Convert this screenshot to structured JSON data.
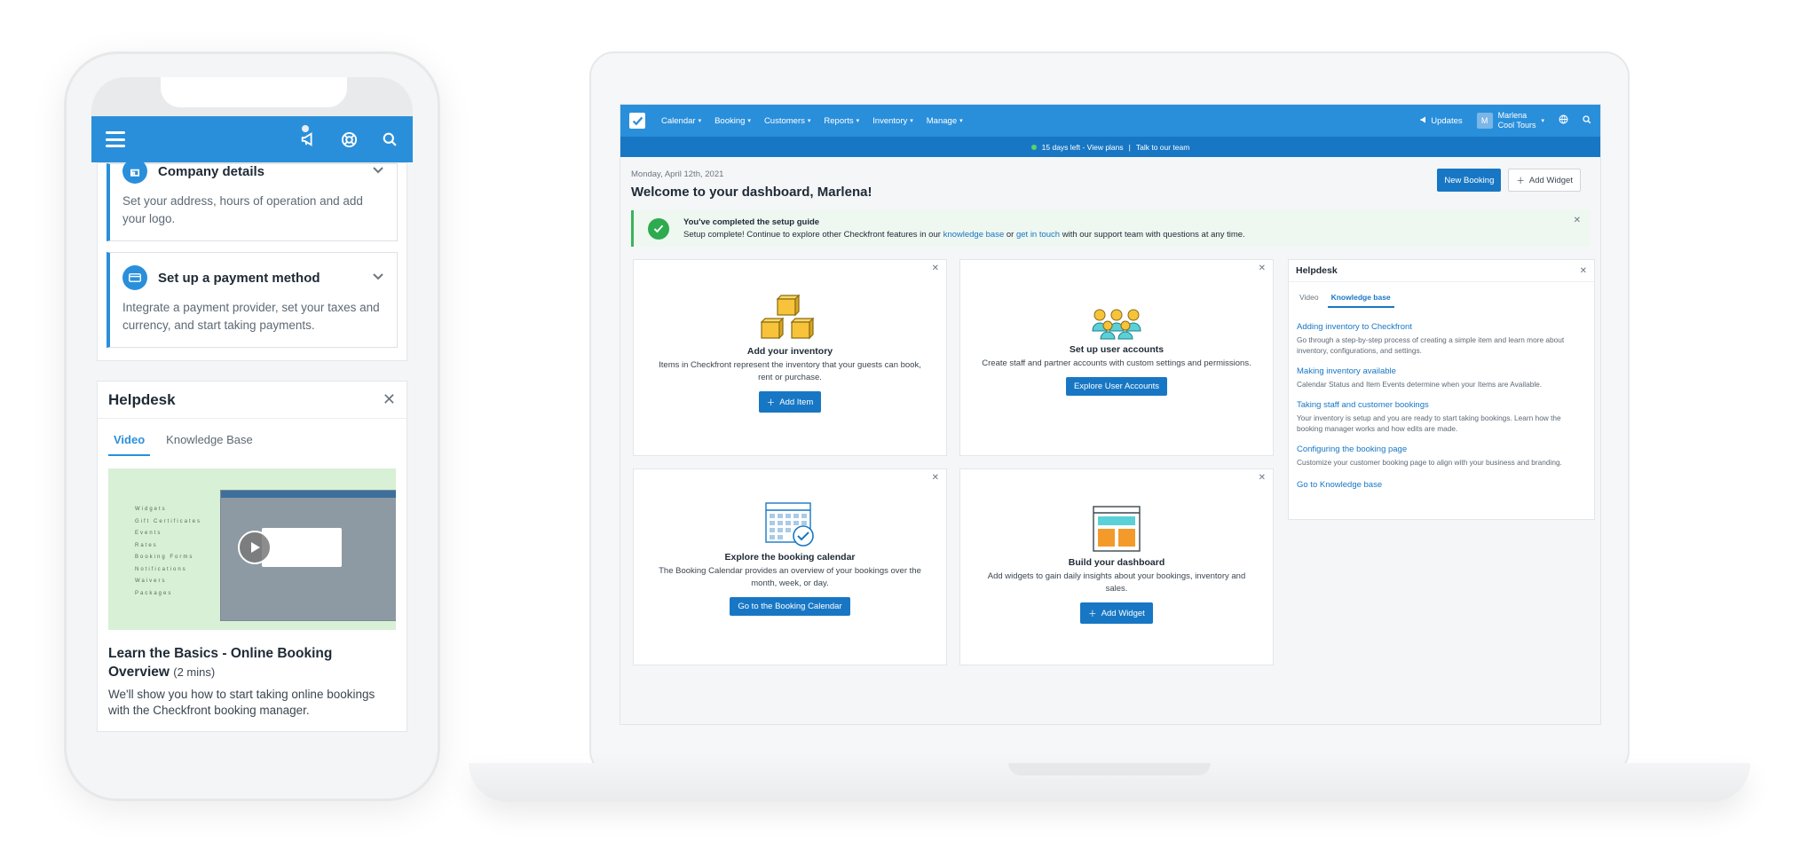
{
  "phone": {
    "cards": [
      {
        "title": "Company details",
        "text": "Set your address, hours of operation and add your logo."
      },
      {
        "title": "Set up a payment method",
        "text": "Integrate a payment provider, set your taxes and currency, and start taking payments."
      }
    ],
    "helpdesk": {
      "title": "Helpdesk",
      "tabs": [
        "Video",
        "Knowledge Base"
      ],
      "video_menu": [
        "Widgets",
        "Gift Certificates",
        "Events",
        "Rates",
        "Booking Forms",
        "Notifications",
        "Waivers",
        "Packages"
      ],
      "video_title": "Learn the Basics - Online Booking Overview",
      "video_duration": "(2 mins)",
      "video_desc": "We'll show you how to start taking online bookings with the Checkfront booking manager."
    }
  },
  "app": {
    "nav": [
      "Calendar",
      "Booking",
      "Customers",
      "Reports",
      "Inventory",
      "Manage"
    ],
    "updates": "Updates",
    "user_initial": "M",
    "user_name": "Marlena",
    "user_company": "Cool Tours",
    "trial_text": "15 days left - View plans",
    "trial_sep": "|",
    "trial_link": "Talk to our team",
    "date": "Monday, April 12th, 2021",
    "welcome": "Welcome to your dashboard, Marlena!",
    "new_booking": "New Booking",
    "add_widget": "Add Widget",
    "alert": {
      "title": "You've completed the setup guide",
      "text_a": "Setup complete! Continue to explore other Checkfront features in our ",
      "link_a": "knowledge base",
      "text_b": " or ",
      "link_b": "get in touch",
      "text_c": " with our support team with questions at any time."
    },
    "widgets": [
      {
        "title": "Add your inventory",
        "desc": "Items in Checkfront represent the inventory that your guests can book, rent or purchase.",
        "button": "Add Item"
      },
      {
        "title": "Set up user accounts",
        "desc": "Create staff and partner accounts with custom settings and permissions.",
        "button": "Explore User Accounts"
      },
      {
        "title": "Explore the booking calendar",
        "desc": "The Booking Calendar provides an overview of your bookings over the month, week, or day.",
        "button": "Go to the Booking Calendar"
      },
      {
        "title": "Build your dashboard",
        "desc": "Add widgets to gain daily insights about your bookings, inventory and sales.",
        "button": "Add Widget"
      }
    ],
    "helpdesk": {
      "title": "Helpdesk",
      "tabs": [
        "Video",
        "Knowledge base"
      ],
      "articles": [
        {
          "title": "Adding inventory to Checkfront",
          "desc": "Go through a step-by-step process of creating a simple item and learn more about inventory, configurations, and settings."
        },
        {
          "title": "Making inventory available",
          "desc": "Calendar Status and Item Events determine when your Items are Available."
        },
        {
          "title": "Taking staff and customer bookings",
          "desc": "Your inventory is setup and you are ready to start taking bookings. Learn how the booking manager works and how edits are made."
        },
        {
          "title": "Configuring the booking page",
          "desc": "Customize your customer booking page to align with your business and branding."
        }
      ],
      "footer_link": "Go to Knowledge base"
    }
  },
  "colors": {
    "brand": "#2a8fdb",
    "brand_dark": "#1877c4",
    "success": "#2eaa4f",
    "icon_yellow": "#f6c33b",
    "icon_orange": "#f39a2b",
    "icon_teal": "#5ad1d6"
  }
}
